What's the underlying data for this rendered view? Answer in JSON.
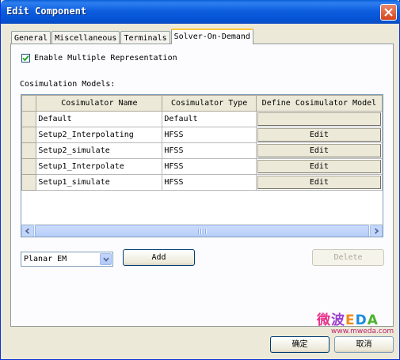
{
  "window": {
    "title": "Edit Component"
  },
  "tabs": [
    {
      "label": "General"
    },
    {
      "label": "Miscellaneous"
    },
    {
      "label": "Terminals"
    },
    {
      "label": "Solver-On-Demand"
    }
  ],
  "options": {
    "enable_multiple_representation": {
      "label": "Enable Multiple Representation",
      "checked": true
    }
  },
  "cosim": {
    "section_label": "Cosimulation Models:",
    "columns": [
      "Cosimulator Name",
      "Cosimulator Type",
      "Define Cosimulator Model"
    ],
    "rows": [
      {
        "name": "Default",
        "type": "Default",
        "define": ""
      },
      {
        "name": "Setup2_Interpolating",
        "type": "HFSS",
        "define": "Edit"
      },
      {
        "name": "Setup2_simulate",
        "type": "HFSS",
        "define": "Edit"
      },
      {
        "name": "Setup1_Interpolate",
        "type": "HFSS",
        "define": "Edit"
      },
      {
        "name": "Setup1_simulate",
        "type": "HFSS",
        "define": "Edit"
      }
    ]
  },
  "controls": {
    "type_select": {
      "value": "Planar EM"
    },
    "add_label": "Add",
    "delete_label": "Delete"
  },
  "footer": {
    "ok_label": "确定",
    "cancel_label": "取消"
  },
  "watermark": {
    "logo": "微波EDA",
    "url": "www.mweda.com"
  },
  "colors": {
    "title_bar": "#0a5fd6",
    "dialog_bg": "#ece9d8",
    "active_tab_accent": "#ffc83c"
  }
}
